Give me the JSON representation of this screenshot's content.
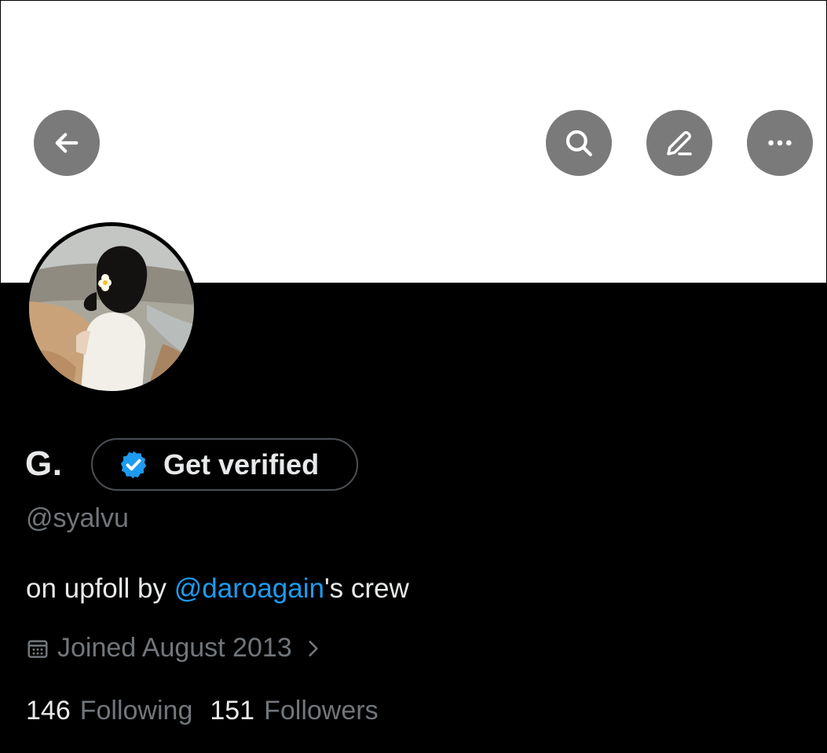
{
  "profile": {
    "display_name": "G.",
    "handle": "@syalvu",
    "verify_button_label": "Get verified",
    "bio_prefix": "on upfoll by ",
    "bio_mention": "@daroagain",
    "bio_suffix": "'s crew",
    "joined_text": "Joined August 2013"
  },
  "stats": {
    "following_count": "146",
    "following_label": "Following",
    "followers_count": "151",
    "followers_label": "Followers"
  },
  "icons": {
    "back": "arrow-left-icon",
    "search": "search-icon",
    "compose": "pencil-icon",
    "more": "more-horizontal-icon",
    "verified": "verified-badge-icon",
    "calendar": "calendar-icon",
    "chevron": "chevron-right-icon"
  },
  "colors": {
    "background": "#000000",
    "banner": "#ffffff",
    "text_primary": "#e7e9ea",
    "text_secondary": "#71767b",
    "accent": "#1d9bf0",
    "nav_button": "#7a7a7a"
  }
}
